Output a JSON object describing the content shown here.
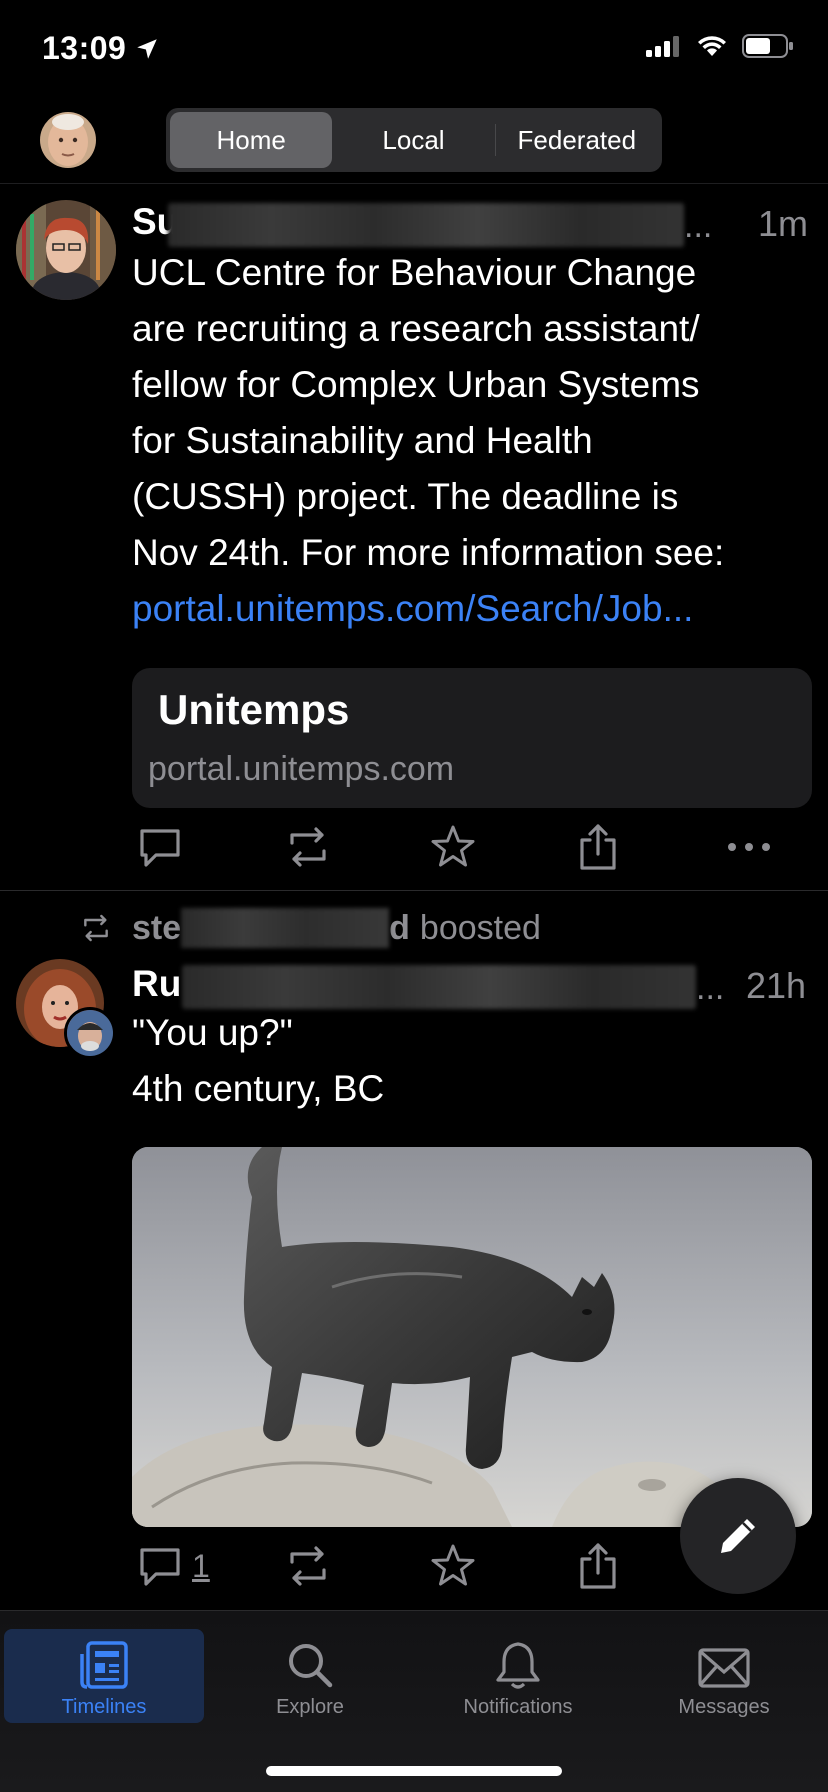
{
  "status_bar": {
    "time": "13:09"
  },
  "top_nav": {
    "tabs": [
      {
        "label": "Home",
        "active": true
      },
      {
        "label": "Local",
        "active": false
      },
      {
        "label": "Federated",
        "active": false
      }
    ]
  },
  "posts": [
    {
      "display_name_visible": "Su",
      "ellipsis": "...",
      "time": "1m",
      "text_lines": [
        "UCL Centre for Behaviour Change",
        "are recruiting a research assistant/",
        "fellow for Complex Urban Systems",
        "for Sustainability and Health",
        "(CUSSH) project. The deadline is",
        "Nov 24th. For more information see:"
      ],
      "link": "portal.unitemps.com/Search/Job...",
      "card": {
        "title": "Unitemps",
        "url": "portal.unitemps.com"
      }
    },
    {
      "boost": {
        "name_start": "ste",
        "name_end": "d",
        "label": "boosted"
      },
      "display_name_visible": "Ru",
      "ellipsis": "...",
      "time": "21h",
      "text_lines": [
        "\"You up?\"",
        "4th century, BC"
      ],
      "reply_count": "1"
    }
  ],
  "tab_bar": {
    "tabs": [
      {
        "label": "Timelines",
        "icon": "timelines-icon",
        "active": true
      },
      {
        "label": "Explore",
        "icon": "search-icon",
        "active": false
      },
      {
        "label": "Notifications",
        "icon": "bell-icon",
        "active": false
      },
      {
        "label": "Messages",
        "icon": "envelope-icon",
        "active": false
      }
    ]
  },
  "colors": {
    "accent": "#3b82f6",
    "secondary_text": "#8e8e93",
    "background": "#000000"
  }
}
